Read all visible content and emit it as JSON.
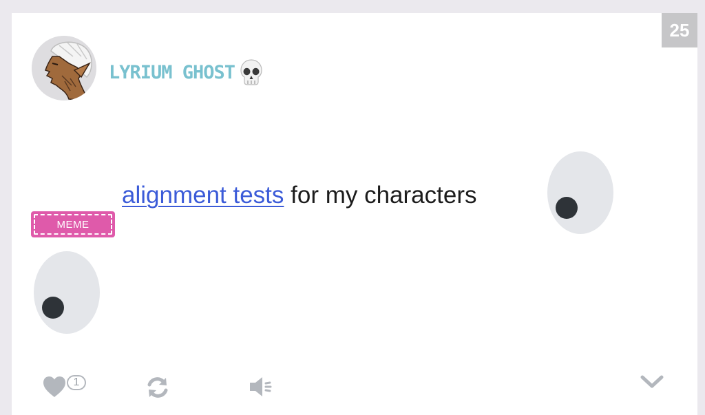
{
  "post": {
    "page_number": "25",
    "author": {
      "name": "LYRIUM GHOST",
      "emoji_icon": "skull-icon"
    },
    "text_link": "alignment tests",
    "text_rest": " for my characters",
    "badge": "MEME",
    "actions": {
      "like_count": "1",
      "like_icon": "heart-icon",
      "reblog_icon": "refresh-icon",
      "sound_icon": "speaker-icon",
      "expand_icon": "chevron-down-icon"
    }
  },
  "colors": {
    "username": "#79c1cf",
    "link": "#3b5bd8",
    "badge": "#df5aaa",
    "page_number_bg": "#c6c6c8",
    "action_icons": "#b3b7bd"
  }
}
